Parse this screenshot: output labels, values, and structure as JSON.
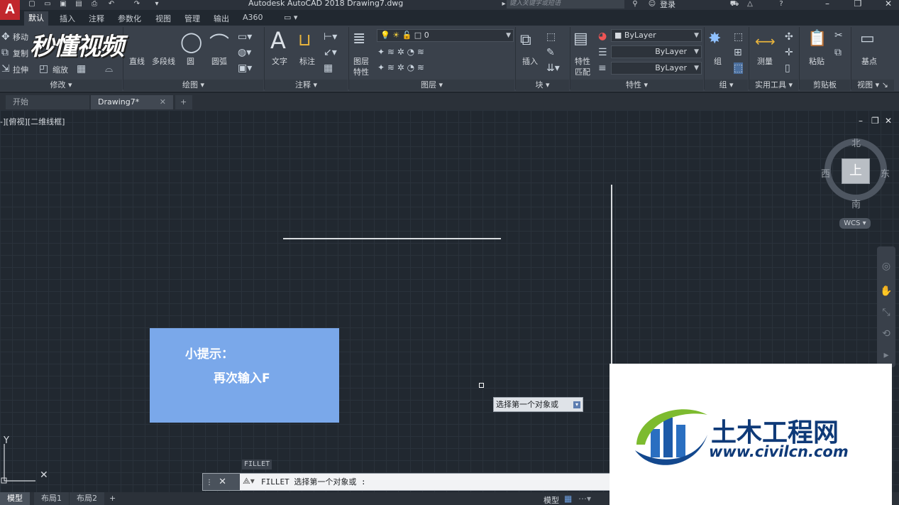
{
  "title_bar": {
    "app_title": "Autodesk AutoCAD 2018   Drawing7.dwg",
    "search_placeholder": "键入关键字或短语",
    "login_label": "登录"
  },
  "ribbon_tabs": [
    "默认",
    "插入",
    "注释",
    "参数化",
    "视图",
    "管理",
    "输出",
    "A360"
  ],
  "ribbon": {
    "modify": {
      "title": "修改",
      "move": "移动",
      "copy": "复制",
      "stretch": "拉伸",
      "scale": "缩放"
    },
    "draw": {
      "title": "绘图",
      "line": "直线",
      "polyline": "多段线",
      "circle": "圆",
      "arc": "圆弧"
    },
    "annotation": {
      "title": "注释",
      "text": "文字",
      "dimension": "标注"
    },
    "layers": {
      "title": "图层",
      "layer_properties_1": "图层",
      "layer_properties_2": "特性",
      "current_layer": "0"
    },
    "block": {
      "title": "块",
      "insert": "插入"
    },
    "properties": {
      "title": "特性",
      "match_1": "特性",
      "match_2": "匹配",
      "color": "ByLayer",
      "linetype": "ByLayer",
      "lineweight": "ByLayer"
    },
    "groups": {
      "title": "组",
      "group": "组"
    },
    "utilities": {
      "title": "实用工具",
      "measure": "测量"
    },
    "clipboard": {
      "title": "剪贴板",
      "paste": "粘贴"
    },
    "view": {
      "title": "视图",
      "base": "基点"
    }
  },
  "watermark_logo": "秒懂视频",
  "doc_tabs": {
    "start": "开始",
    "drawing": "Drawing7*"
  },
  "viewport": {
    "label": "-][俯视][二维线框]"
  },
  "viewcube": {
    "face": "上",
    "north": "北",
    "south": "南",
    "east": "东",
    "west": "西",
    "wcs": "WCS"
  },
  "tip": {
    "title": "小提示：",
    "body": "再次输入F"
  },
  "cursor_prompt": "选择第一个对象或",
  "command": {
    "history": "FILLET",
    "line": "FILLET 选择第一个对象或 :"
  },
  "status_bar": {
    "model": "模型",
    "layout1": "布局1",
    "layout2": "布局2",
    "model_space": "模型"
  },
  "civil_watermark": {
    "name": "土木工程网",
    "url": "www.civilcn.com"
  }
}
